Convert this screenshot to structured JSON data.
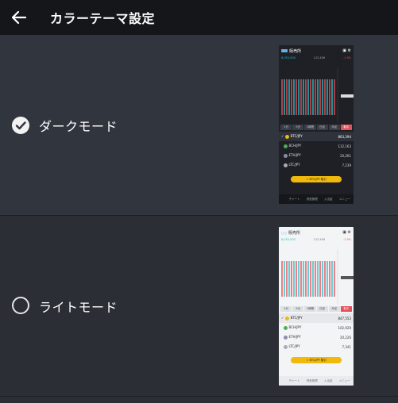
{
  "header": {
    "title": "カラーテーマ設定"
  },
  "options": [
    {
      "label": "ダークモード",
      "selected": true
    },
    {
      "label": "ライトモード",
      "selected": false
    }
  ],
  "preview": {
    "app_title": "販売所",
    "pairs": [
      "BTC/JPY",
      "BCH/JPY",
      "ETH/JPY",
      "LTC/JPY"
    ],
    "prices": [
      "863,394",
      "112,163",
      "20,261",
      "7,239"
    ],
    "light_prices": [
      "847,553",
      "102,929",
      "20,226",
      "7,341"
    ],
    "button": "☆ BTC/JPY 取引",
    "nav": [
      "",
      "チャート",
      "資産管理",
      "入出金",
      "メニュー"
    ],
    "tabs": [
      "1分",
      "5分",
      "1時間",
      "日足",
      "月足",
      "取引"
    ],
    "colors": {
      "up": "#e6505a",
      "down": "#2bbdc6",
      "accent": "#f0b90b"
    }
  }
}
